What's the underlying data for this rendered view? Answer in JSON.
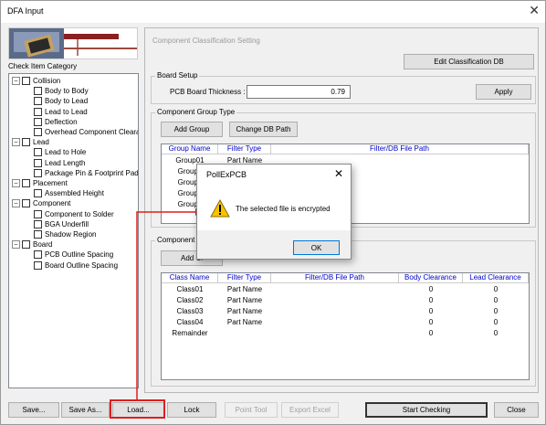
{
  "window": {
    "title": "DFA Input",
    "close_glyph": "✕"
  },
  "left": {
    "category_label": "Check Item Category",
    "tree": [
      {
        "label": "Collision",
        "level": 0
      },
      {
        "label": "Body to Body",
        "level": 1
      },
      {
        "label": "Body to Lead",
        "level": 1
      },
      {
        "label": "Lead to Lead",
        "level": 1
      },
      {
        "label": "Deflection",
        "level": 1
      },
      {
        "label": "Overhead Component Clearan",
        "level": 1
      },
      {
        "label": "Lead",
        "level": 0
      },
      {
        "label": "Lead to Hole",
        "level": 1
      },
      {
        "label": "Lead Length",
        "level": 1
      },
      {
        "label": "Package Pin & Footprint Pad",
        "level": 1
      },
      {
        "label": "Placement",
        "level": 0
      },
      {
        "label": "Assembled Height",
        "level": 1
      },
      {
        "label": "Component",
        "level": 0
      },
      {
        "label": "Component to Solder",
        "level": 1
      },
      {
        "label": "BGA Underfill",
        "level": 1
      },
      {
        "label": "Shadow Region",
        "level": 1
      },
      {
        "label": "Board",
        "level": 0
      },
      {
        "label": "PCB Outline Spacing",
        "level": 1
      },
      {
        "label": "Board Outline Spacing",
        "level": 1
      }
    ]
  },
  "panel": {
    "title": "Component Classification Setting",
    "edit_db_label": "Edit Classification DB",
    "board_setup": {
      "group_label": "Board Setup",
      "thickness_label": "PCB Board Thickness :",
      "thickness_value": "0.79",
      "apply_label": "Apply"
    },
    "group_type": {
      "group_label": "Component Group Type",
      "add_group_label": "Add Group",
      "change_db_label": "Change DB Path",
      "columns": [
        "Group Name",
        "Filter Type",
        "Filter/DB File Path"
      ],
      "rows": [
        [
          "Group01",
          "Part Name",
          ""
        ],
        [
          "Group0",
          "",
          ""
        ],
        [
          "Group0",
          "",
          ""
        ],
        [
          "Group0",
          "",
          ""
        ],
        [
          "Group0",
          "",
          ""
        ]
      ]
    },
    "class_type": {
      "group_label": "Component C",
      "add_class_label": "Add Cl",
      "columns": [
        "Class Name",
        "Filter Type",
        "Filter/DB File Path",
        "Body Clearance",
        "Lead Clearance"
      ],
      "rows": [
        [
          "Class01",
          "Part Name",
          "",
          "0",
          "0"
        ],
        [
          "Class02",
          "Part Name",
          "",
          "0",
          "0"
        ],
        [
          "Class03",
          "Part Name",
          "",
          "0",
          "0"
        ],
        [
          "Class04",
          "Part Name",
          "",
          "0",
          "0"
        ],
        [
          "Remainder",
          "",
          "",
          "0",
          "0"
        ]
      ]
    }
  },
  "footer": {
    "save": "Save...",
    "save_as": "Save As...",
    "load": "Load...",
    "lock": "Lock",
    "point_tool": "Point Tool",
    "export_excel": "Export Excel",
    "start_checking": "Start Checking",
    "close": "Close"
  },
  "dialog": {
    "title": "PollExPCB",
    "message": "The selected file is encrypted",
    "ok_label": "OK",
    "icon": "warning-icon",
    "close_glyph": "✕"
  },
  "colors": {
    "highlight_red": "#e01e1e",
    "header_blue": "#0000cc",
    "warning_yellow": "#f5c400"
  }
}
